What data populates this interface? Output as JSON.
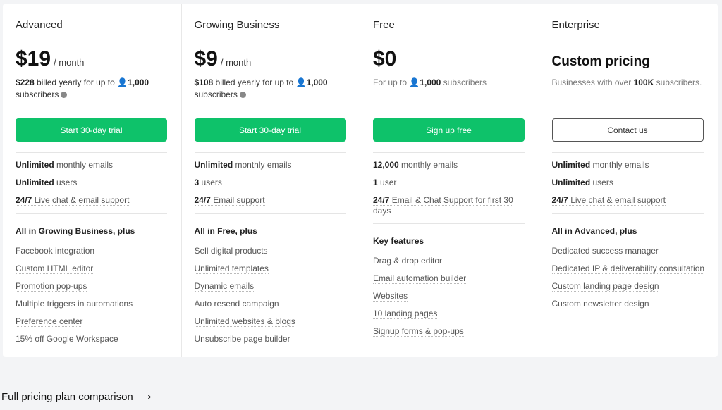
{
  "plans": [
    {
      "name": "Advanced",
      "price": "$19",
      "per": "/ month",
      "billed": "$228",
      "billed_rest": " billed yearly for up to ",
      "subs": "1,000",
      "subs_word": "subscribers",
      "button": "Start 30-day trial",
      "stats": [
        [
          "Unlimited",
          " monthly emails"
        ],
        [
          "Unlimited",
          " users"
        ],
        [
          "24/7",
          " Live chat & email support"
        ]
      ],
      "features_header": "All in Growing Business, plus",
      "features": [
        "Facebook integration",
        "Custom HTML editor",
        "Promotion pop-ups",
        "Multiple triggers in automations",
        "Preference center",
        "15% off Google Workspace"
      ]
    },
    {
      "name": "Growing Business",
      "price": "$9",
      "per": "/ month",
      "billed": "$108",
      "billed_rest": " billed yearly for up to ",
      "subs": "1,000",
      "subs_word": "subscribers",
      "button": "Start 30-day trial",
      "stats": [
        [
          "Unlimited",
          " monthly emails"
        ],
        [
          "3",
          " users"
        ],
        [
          "24/7",
          " Email support"
        ]
      ],
      "features_header": "All in Free, plus",
      "features": [
        "Sell digital products",
        "Unlimited templates",
        "Dynamic emails",
        "Auto resend campaign",
        "Unlimited websites & blogs",
        "Unsubscribe page builder"
      ]
    },
    {
      "name": "Free",
      "price": "$0",
      "desc_pre": "For up to ",
      "subs": "1,000",
      "subs_word": " subscribers",
      "button": "Sign up free",
      "stats": [
        [
          "12,000",
          " monthly emails"
        ],
        [
          "1",
          " user"
        ],
        [
          "24/7",
          " Email & Chat Support for first 30 days"
        ]
      ],
      "features_header": "Key features",
      "features": [
        "Drag & drop editor",
        "Email automation builder",
        "Websites",
        "10 landing pages",
        "Signup forms & pop-ups"
      ]
    },
    {
      "name": "Enterprise",
      "price": "Custom pricing",
      "desc_pre": "Businesses with over ",
      "desc_bold": "100K",
      "desc_post": " subscribers.",
      "button": "Contact us",
      "stats": [
        [
          "Unlimited",
          " monthly emails"
        ],
        [
          "Unlimited",
          " users"
        ],
        [
          "24/7",
          " Live chat & email support"
        ]
      ],
      "features_header": "All in Advanced, plus",
      "features": [
        "Dedicated success manager",
        "Dedicated IP & deliverability consultation",
        "Custom landing page design",
        "Custom newsletter design"
      ]
    }
  ],
  "footer": {
    "link": "Full pricing plan comparison",
    "arrow": "⟶"
  },
  "colors": {
    "accent": "#0ec26a"
  }
}
